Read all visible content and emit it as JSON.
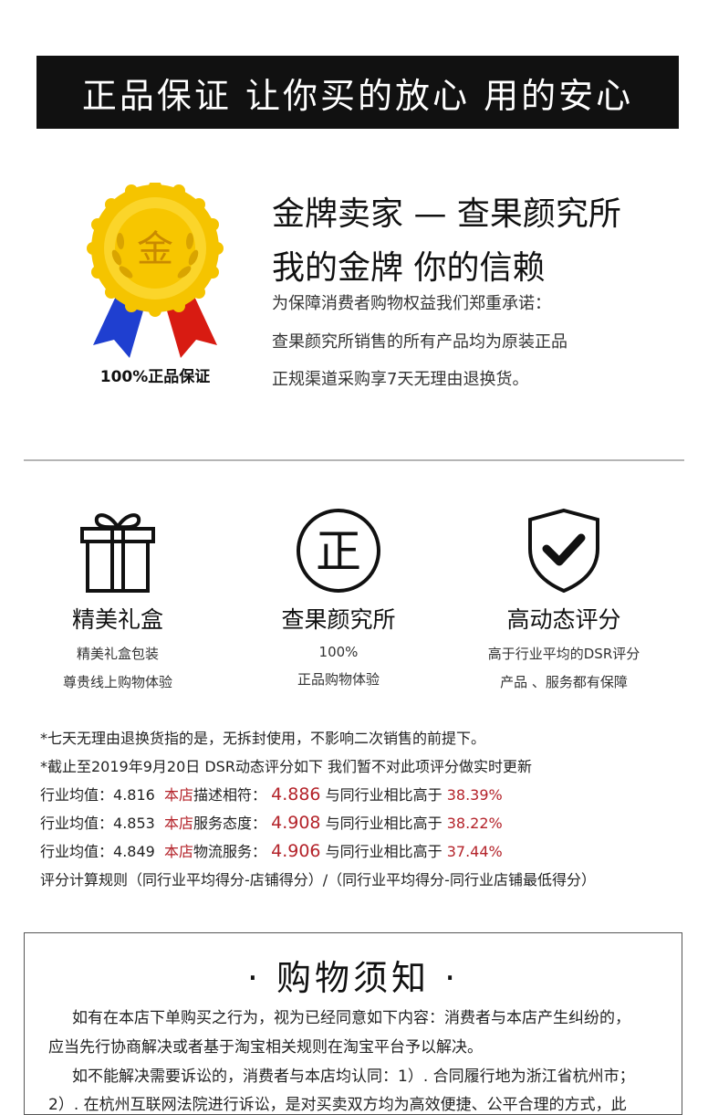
{
  "banner": {
    "text": "正品保证 让你买的放心 用的安心"
  },
  "medal": {
    "glyph": "金",
    "caption": "100%正品保证",
    "colors": {
      "gold": "#f5c400",
      "ribbon_blue": "#1f3fd0",
      "ribbon_red": "#d81b12"
    }
  },
  "seller": {
    "title": "金牌卖家 — 查果颜究所",
    "subtitle": "我的金牌  你的信赖",
    "promises": [
      "为保障消费者购物权益我们郑重承诺：",
      "查果颜究所销售的所有产品均为原装正品",
      "正规渠道采购享7天无理由退换货。"
    ]
  },
  "features": [
    {
      "icon": "gift-box-icon",
      "title": "精美礼盒",
      "lines": [
        "精美礼盒包装",
        "尊贵线上购物体验"
      ]
    },
    {
      "icon": "zheng-seal-icon",
      "glyph": "正",
      "title": "查果颜究所",
      "lines": [
        "100%",
        "正品购物体验"
      ]
    },
    {
      "icon": "shield-check-icon",
      "title": "高动态评分",
      "lines": [
        "高于行业平均的DSR评分",
        "产品 、服务都有保障"
      ]
    }
  ],
  "notes": {
    "line1": "*七天无理由退换货指的是，无拆封使用，不影响二次销售的前提下。",
    "line2": "*截止至2019年9月20日 DSR动态评分如下 我们暂不对此项评分做实时更新",
    "ratings": [
      {
        "industry_label": "行业均值：",
        "industry_value": "4.816",
        "store_label": "本店",
        "metric": "描述相符：",
        "store_value": "4.886",
        "compare": "与同行业相比高于",
        "percent": "38.39%"
      },
      {
        "industry_label": "行业均值：",
        "industry_value": "4.853",
        "store_label": "本店",
        "metric": "服务态度：",
        "store_value": "4.908",
        "compare": "与同行业相比高于",
        "percent": "38.22%"
      },
      {
        "industry_label": "行业均值：",
        "industry_value": "4.849",
        "store_label": "本店",
        "metric": "物流服务：",
        "store_value": "4.906",
        "compare": "与同行业相比高于",
        "percent": "37.44%"
      }
    ],
    "formula": "评分计算规则（同行业平均得分-店铺得分）/（同行业平均得分-同行业店铺最低得分）",
    "accent_color": "#b4232a"
  },
  "shopping": {
    "title": "· 购物须知 ·",
    "paragraphs": [
      "如有在本店下单购买之行为，视为已经同意如下内容：消费者与本店产生纠纷的，",
      "应当先行协商解决或者基于淘宝相关规则在淘宝平台予以解决。",
      "如不能解决需要诉讼的，消费者与本店均认同：1）. 合同履行地为浙江省杭州市；",
      "2）. 在杭州互联网法院进行诉讼，是对买卖双方均为高效便捷、公平合理的方式，此"
    ]
  }
}
